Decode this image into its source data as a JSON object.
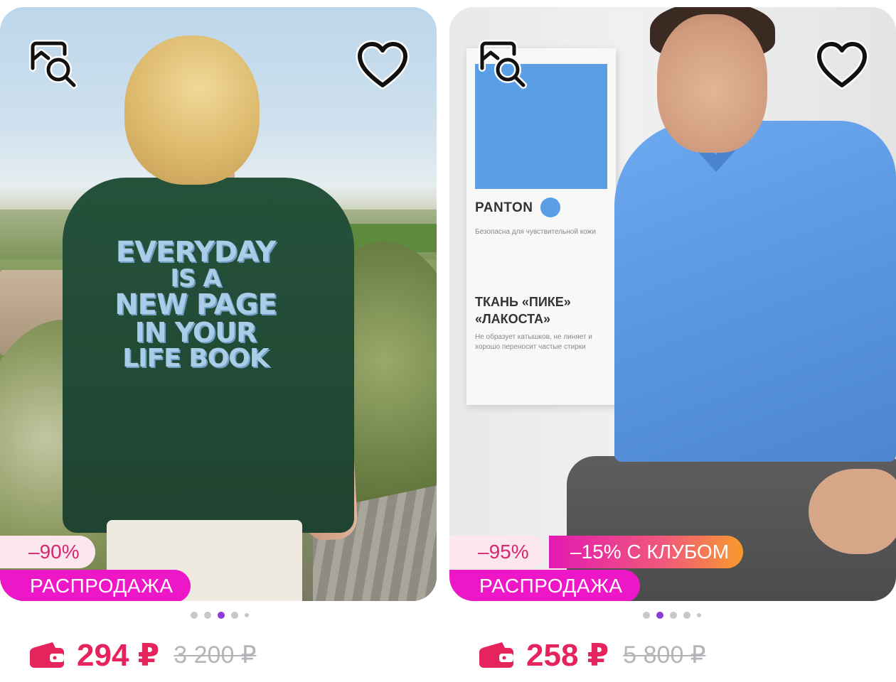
{
  "products": [
    {
      "image_print_text": [
        "EVERYDAY",
        "IS A",
        "NEW PAGE",
        "IN YOUR",
        "LIFE BOOK"
      ],
      "discount_badge": "–90%",
      "sale_badge": "РАСПРОДАЖА",
      "price": "294 ₽",
      "old_price": "3 200 ₽",
      "gallery_dots": 5,
      "active_dot": 2
    },
    {
      "info_card": {
        "swatch_label": "PANTON",
        "swatch_note": "Безопасна для чувствительной кожи",
        "fabric_title": "ТКАНЬ «ПИКЕ» «ЛАКОСТА»",
        "fabric_note": "Не образует катышков, не линяет и хорошо переносит частые стирки"
      },
      "discount_badge": "–95%",
      "club_badge": "–15% С КЛУБОМ",
      "sale_badge": "РАСПРОДАЖА",
      "price": "258 ₽",
      "old_price": "5 800 ₽",
      "gallery_dots": 5,
      "active_dot": 1
    }
  ],
  "icons": {
    "search": "image-search-icon",
    "favorite": "heart-outline-icon",
    "wallet": "wallet-icon"
  },
  "colors": {
    "price": "#e5245e",
    "sale_badge": "#ee17c8",
    "discount_bg": "#fde7ee",
    "discount_text": "#d6286e",
    "active_dot": "#8b3dd6",
    "old_price": "#b5b5b9"
  }
}
